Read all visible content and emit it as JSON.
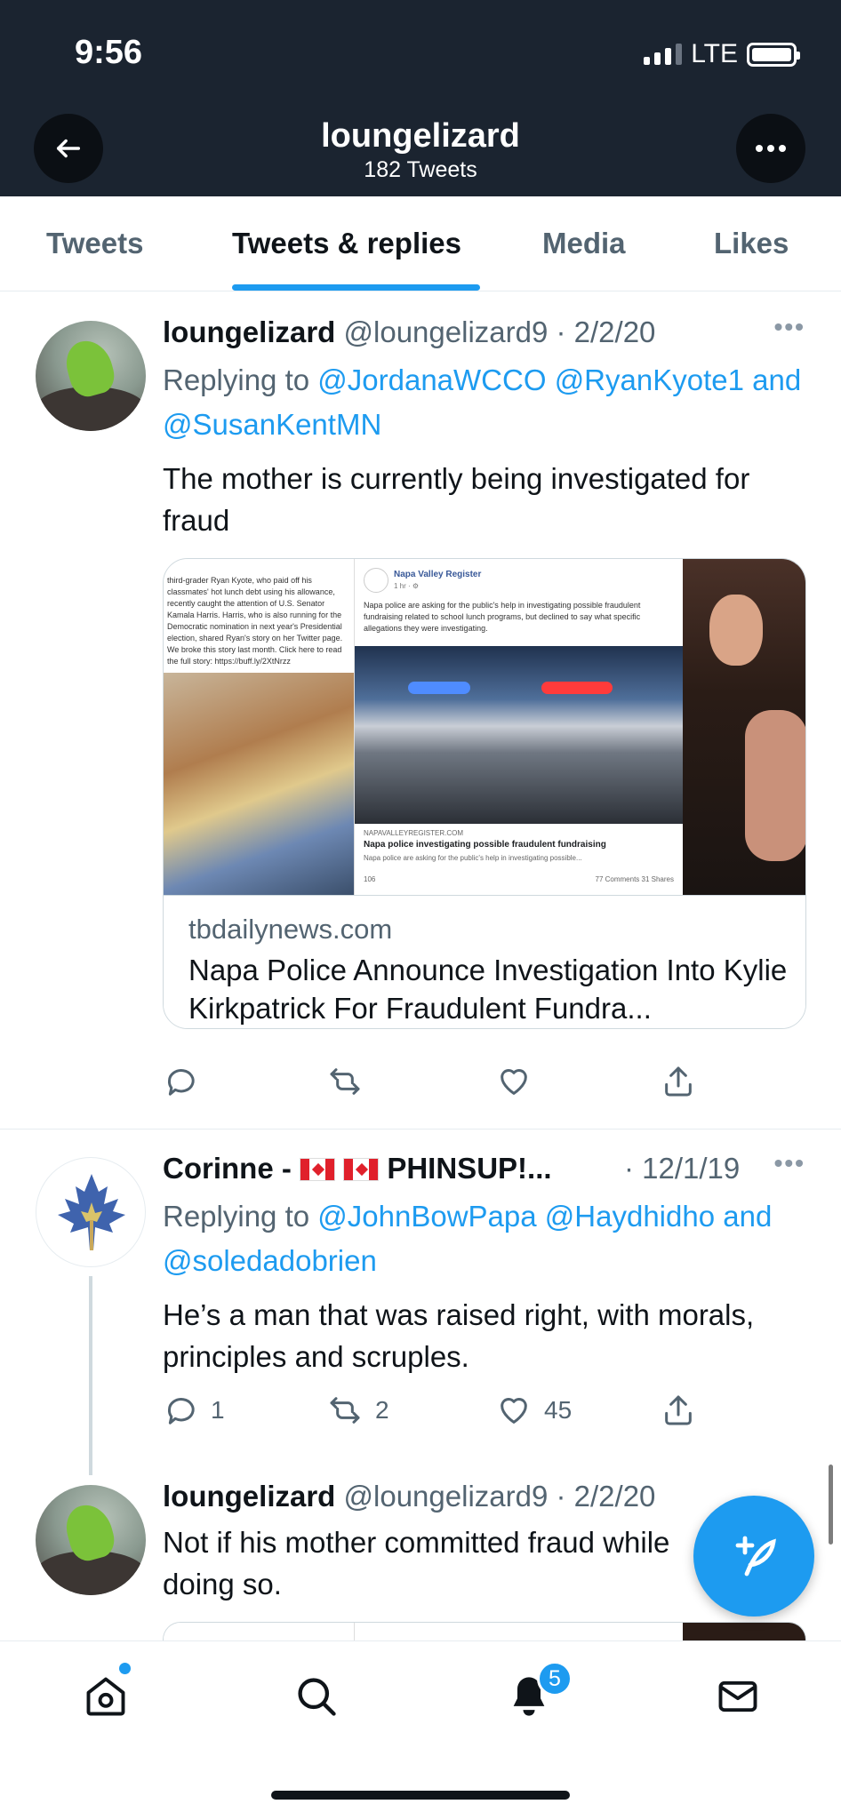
{
  "status_bar": {
    "time": "9:56",
    "network": "LTE"
  },
  "header": {
    "name": "loungelizard",
    "tweet_count": "182 Tweets"
  },
  "tabs": [
    {
      "label": "Tweets"
    },
    {
      "label": "Tweets & replies"
    },
    {
      "label": "Media"
    },
    {
      "label": "Likes"
    }
  ],
  "tweets": [
    {
      "name": "loungelizard",
      "handle": "@loungelizard9",
      "date": "· 2/2/20",
      "replying_prefix": "Replying to",
      "mention_1": "@JordanaWCCO",
      "mention_2": "@RyanKyote1",
      "and_word": "and",
      "mention_3": "@SusanKentMN",
      "text": "The mother is currently being investigated for fraud",
      "card": {
        "left_snippet": "third-grader Ryan Kyote, who paid off his classmates' hot lunch debt using his allowance, recently caught the attention of U.S. Senator Kamala Harris. Harris, who is also running for the Democratic nomination in next year's Presidential election, shared Ryan's story on her Twitter page. We broke this story last month. Click here to read the full story: https://buff.ly/2XtNrzz",
        "source_name": "Napa Valley Register",
        "source_time": "1 hr · ⚙",
        "description": "Napa police are asking for the public's help in investigating possible fraudulent fundraising related to school lunch programs, but declined to say what specific allegations they were investigating.",
        "caption_source": "NAPAVALLEYREGISTER.COM",
        "caption_title": "Napa police investigating possible fraudulent fundraising",
        "caption_sub": "Napa police are asking for the public's help in investigating possible...",
        "reactions": "106",
        "engagement": "77 Comments  31 Shares",
        "domain": "tbdailynews.com",
        "title": "Napa Police Announce Investigation Into Kylie Kirkpatrick For Fraudulent Fundra..."
      }
    },
    {
      "name": "Corinne -",
      "name_suffix": "PHINSUP!...",
      "date": "· 12/1/19",
      "replying_prefix": "Replying to",
      "mention_1": "@JohnBowPapa",
      "mention_2": "@Haydhidho",
      "and_word": "and",
      "mention_3": "@soledadobrien",
      "text": "He’s a man that was raised right, with morals, principles and scruples.",
      "replies": "1",
      "retweets": "2",
      "likes": "45"
    },
    {
      "name": "loungelizard",
      "handle": "@loungelizard9",
      "date": "· 2/2/20",
      "text": "Not if his mother committed fraud while doing so."
    }
  ],
  "notifications_badge": "5",
  "colors": {
    "accent": "#1d9bf0",
    "header_bg": "#1b2430",
    "text": "#0f1419",
    "secondary": "#536471"
  },
  "icons": [
    "back-arrow-icon",
    "more-icon",
    "reply-icon",
    "retweet-icon",
    "like-icon",
    "share-icon",
    "compose-icon",
    "home-icon",
    "search-icon",
    "bell-icon",
    "mail-icon"
  ]
}
